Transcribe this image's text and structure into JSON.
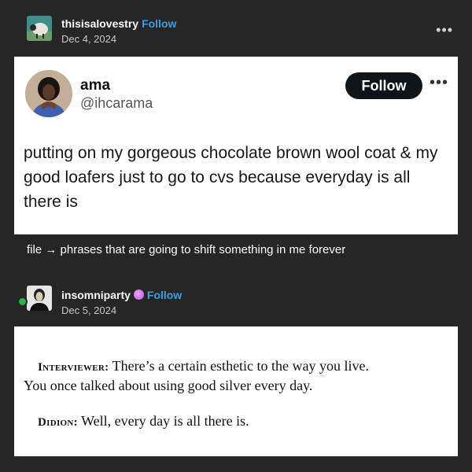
{
  "post1": {
    "username": "thisisalovestry",
    "follow_label": "Follow",
    "date": "Dec 4, 2024",
    "more_label": "•••"
  },
  "tweet": {
    "display_name": "ama",
    "handle": "@ihcarama",
    "follow_label": "Follow",
    "more_label": "•••",
    "text": "putting on my gorgeous chocolate brown wool coat & my good loafers just to go to cvs because everyday is all there is"
  },
  "caption": "file → phrases that are going to shift something in me forever",
  "post2": {
    "username": "insomniparty",
    "follow_label": "Follow",
    "date": "Dec 5, 2024"
  },
  "quote": {
    "speaker1": "Interviewer:",
    "line1": "There’s a certain esthetic to the way you live.",
    "line2": "You once talked about using good silver every day.",
    "speaker2": "Didion:",
    "line3": "Well, every day is all there is."
  },
  "colors": {
    "background": "#262626",
    "follow_link": "#3a9fe6",
    "follow_button": "#0f1419",
    "badge_green": "#2cb34a"
  }
}
